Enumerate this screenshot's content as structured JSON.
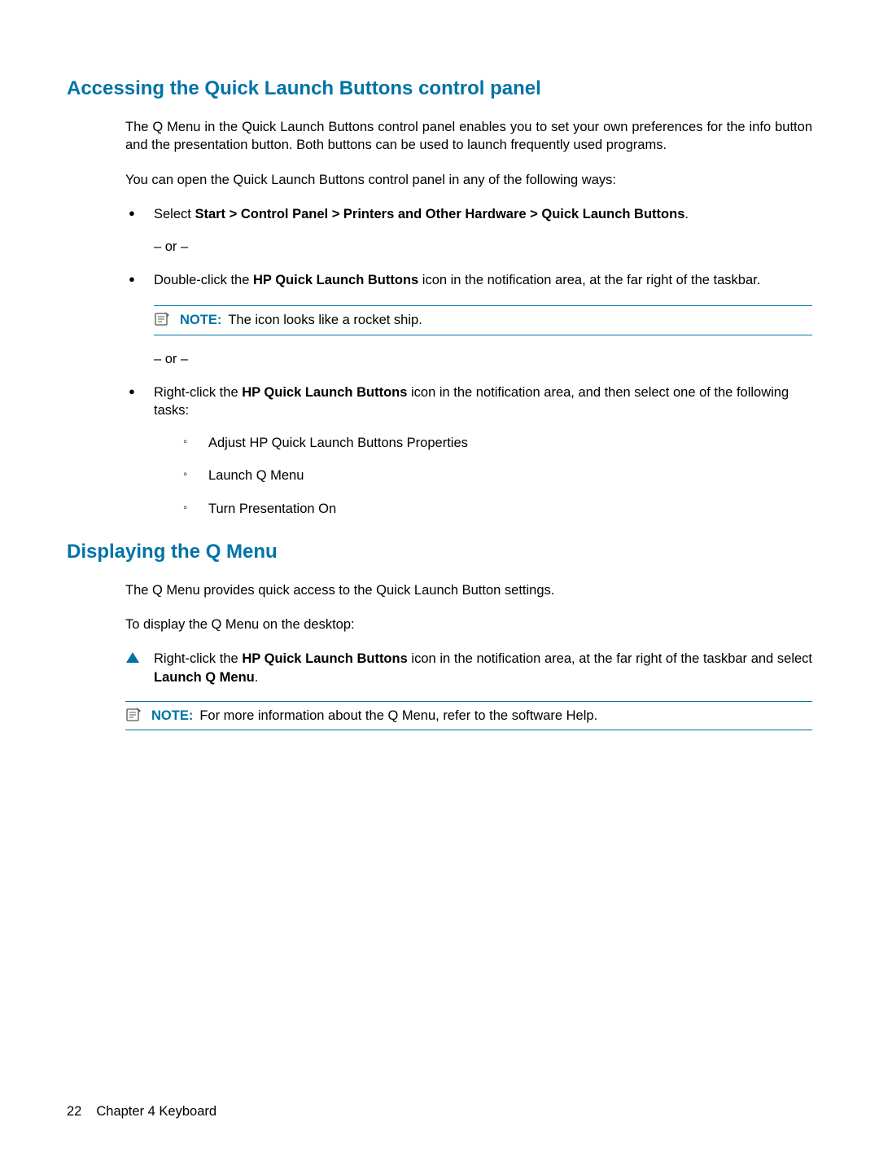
{
  "section1": {
    "heading": "Accessing the Quick Launch Buttons control panel",
    "para1": "The Q Menu in the Quick Launch Buttons control panel enables you to set your own preferences for the info button and the presentation button. Both buttons can be used to launch frequently used programs.",
    "para2": "You can open the Quick Launch Buttons control panel in any of the following ways:",
    "bullet1_prefix": "Select ",
    "bullet1_bold": "Start > Control Panel > Printers and Other Hardware > Quick Launch Buttons",
    "bullet1_suffix": ".",
    "or": "– or –",
    "bullet2_prefix": "Double-click the ",
    "bullet2_bold": "HP Quick Launch Buttons",
    "bullet2_suffix": " icon in the notification area, at the far right of the taskbar.",
    "note1_label": "NOTE:",
    "note1_text": "The icon looks like a rocket ship.",
    "bullet3_prefix": "Right-click the ",
    "bullet3_bold": "HP Quick Launch Buttons",
    "bullet3_suffix": " icon in the notification area, and then select one of the following tasks:",
    "sub1": "Adjust HP Quick Launch Buttons Properties",
    "sub2": "Launch Q Menu",
    "sub3": "Turn Presentation On"
  },
  "section2": {
    "heading": "Displaying the Q Menu",
    "para1": "The Q Menu provides quick access to the Quick Launch Button settings.",
    "para2": "To display the Q Menu on the desktop:",
    "triangle_prefix": "Right-click the ",
    "triangle_bold1": "HP Quick Launch Buttons",
    "triangle_mid": " icon in the notification area, at the far right of the taskbar and select ",
    "triangle_bold2": "Launch Q Menu",
    "triangle_suffix": ".",
    "note2_label": "NOTE:",
    "note2_text": "For more information about the Q Menu, refer to the software Help."
  },
  "footer": {
    "page": "22",
    "chapter": "Chapter 4   Keyboard"
  }
}
